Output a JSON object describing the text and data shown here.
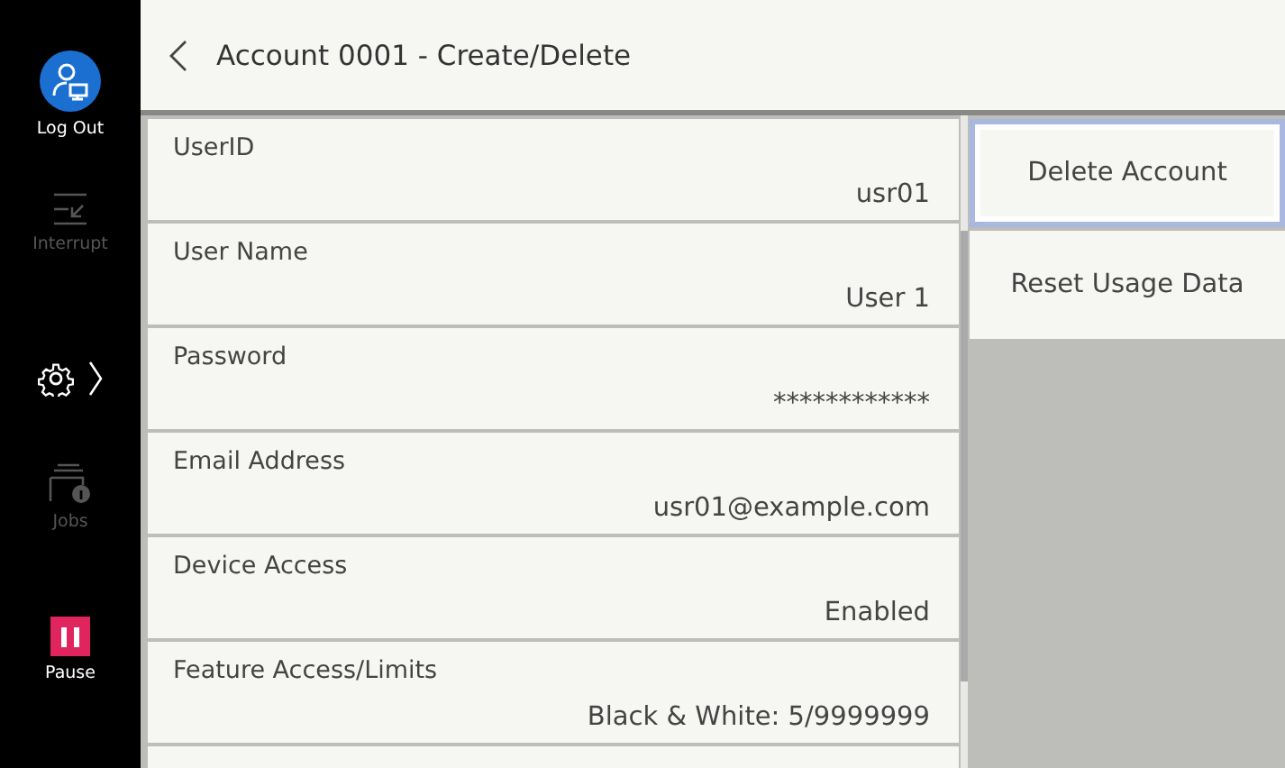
{
  "sidebar": {
    "items": [
      {
        "kind": "logout",
        "label": "Log Out",
        "disabled": false
      },
      {
        "kind": "interrupt",
        "label": "Interrupt",
        "disabled": true
      },
      {
        "kind": "settings",
        "disabled": false
      },
      {
        "kind": "jobs",
        "label": "Jobs",
        "disabled": true
      },
      {
        "kind": "pause",
        "label": "Pause",
        "disabled": false
      }
    ]
  },
  "header": {
    "title": "Account 0001 - Create/Delete"
  },
  "fields": [
    {
      "label": "UserID",
      "value": "usr01"
    },
    {
      "label": "User Name",
      "value": "User 1"
    },
    {
      "label": "Password",
      "value": "************"
    },
    {
      "label": "Email Address",
      "value": "usr01@example.com"
    },
    {
      "label": "Device Access",
      "value": "Enabled"
    },
    {
      "label": "Feature Access/Limits",
      "value": "Black & White: 5/9999999"
    }
  ],
  "actions": [
    {
      "label": "Delete Account",
      "selected": true
    },
    {
      "label": "Reset Usage Data",
      "selected": false
    }
  ]
}
